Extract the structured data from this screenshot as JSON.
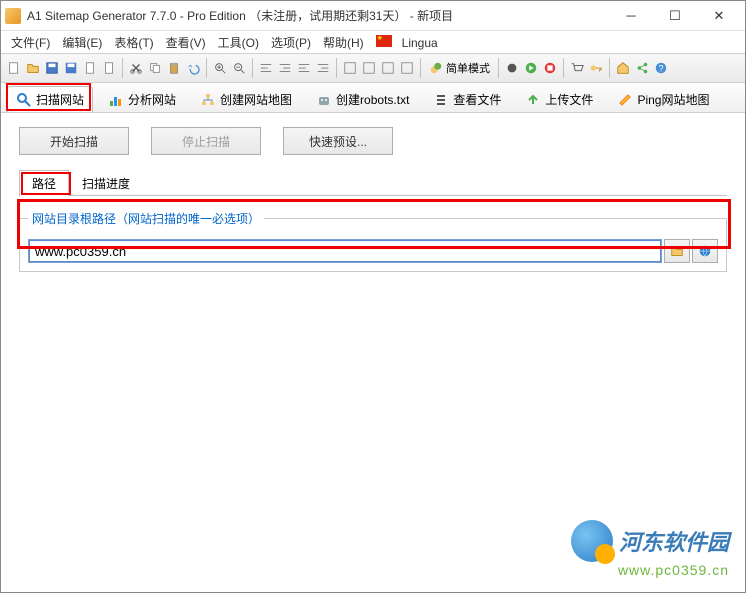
{
  "window": {
    "title": "A1 Sitemap Generator 7.7.0 - Pro Edition （未注册，试用期还剩31天） - 新项目"
  },
  "menu": {
    "file": "文件(F)",
    "edit": "编辑(E)",
    "table": "表格(T)",
    "view": "查看(V)",
    "tools": "工具(O)",
    "options": "选项(P)",
    "help": "帮助(H)",
    "lingua": "Lingua"
  },
  "toolbar": {
    "simple_mode": "简单模式"
  },
  "maintabs": {
    "scan_site": "扫描网站",
    "analyze_site": "分析网站",
    "create_sitemap": "创建网站地图",
    "create_robots": "创建robots.txt",
    "view_files": "查看文件",
    "upload_files": "上传文件",
    "ping_sitemap": "Ping网站地图"
  },
  "buttons": {
    "start_scan": "开始扫描",
    "stop_scan": "停止扫描",
    "quick_preset": "快速预设..."
  },
  "subtabs": {
    "path": "路径",
    "scan_progress": "扫描进度"
  },
  "field": {
    "legend": "网站目录根路径（网站扫描的唯一必选项）",
    "value": "www.pc0359.cn"
  },
  "watermark": {
    "name": "河东软件园",
    "url": "www.pc0359.cn"
  }
}
